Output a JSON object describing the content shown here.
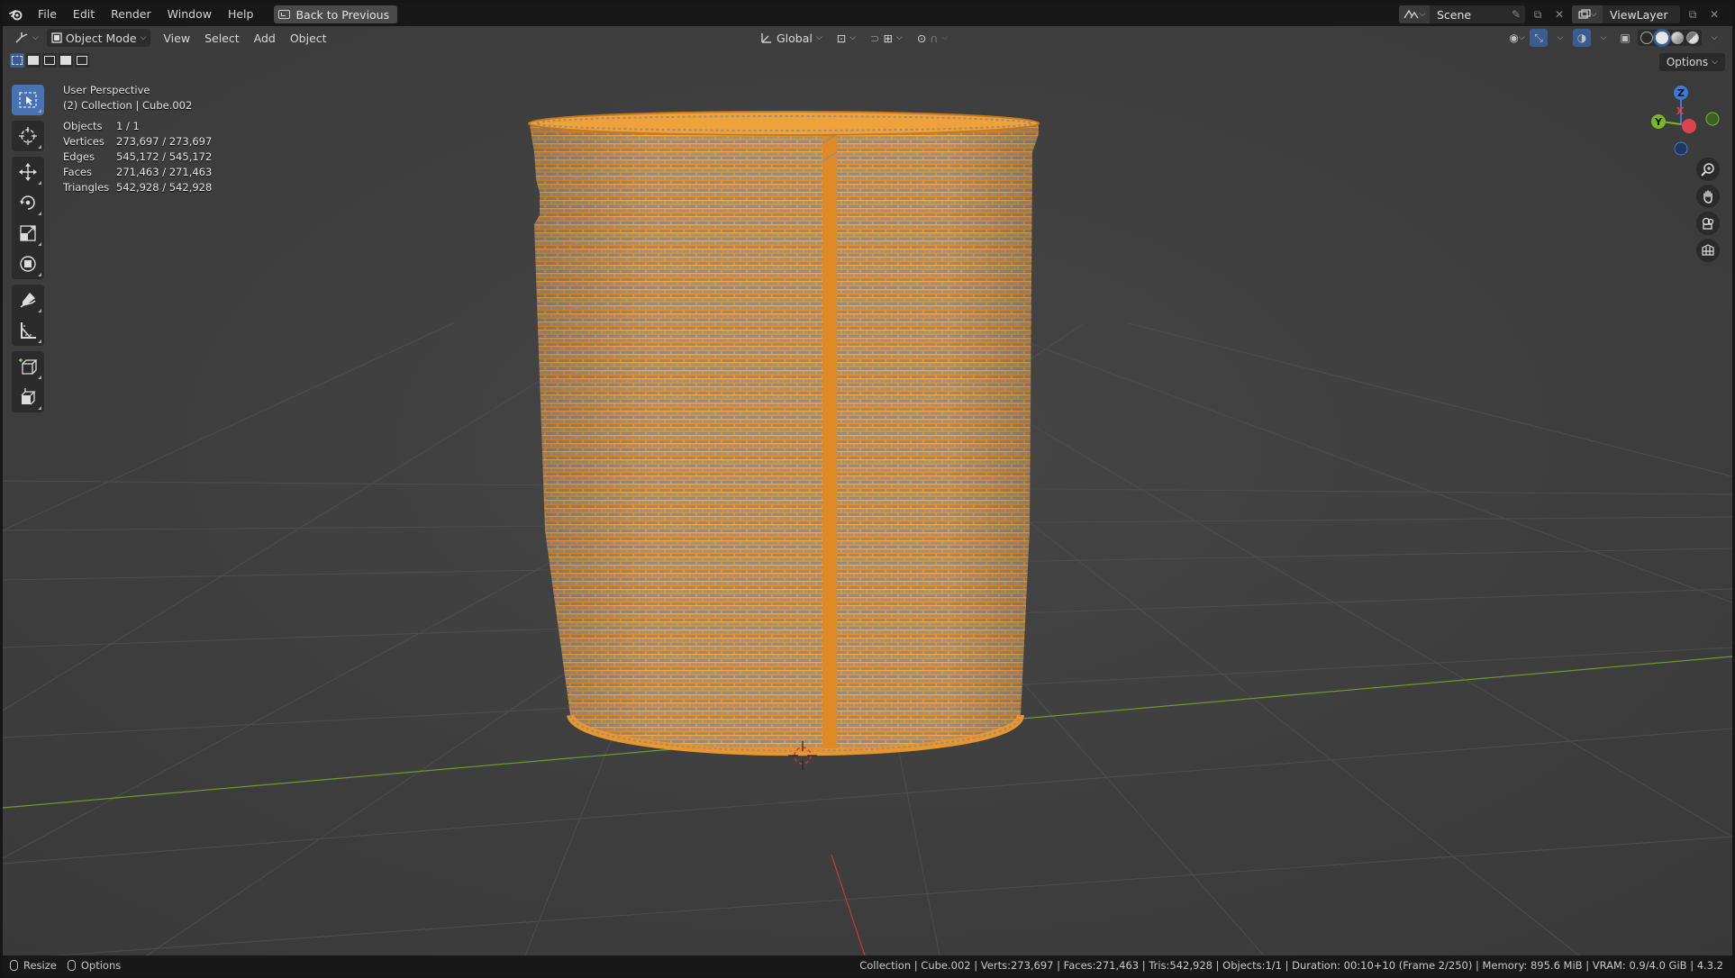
{
  "menubar": {
    "items": [
      "File",
      "Edit",
      "Render",
      "Window",
      "Help"
    ],
    "back_button": "Back to Previous",
    "scene": "Scene",
    "view_layer": "ViewLayer"
  },
  "viewport_header": {
    "mode": "Object Mode",
    "menus": [
      "View",
      "Select",
      "Add",
      "Object"
    ],
    "orientation": "Global",
    "options": "Options"
  },
  "overlay": {
    "perspective": "User Perspective",
    "collection": "(2) Collection | Cube.002",
    "stats": [
      {
        "label": "Objects",
        "value": "1 / 1"
      },
      {
        "label": "Vertices",
        "value": "273,697 / 273,697"
      },
      {
        "label": "Edges",
        "value": "545,172 / 545,172"
      },
      {
        "label": "Faces",
        "value": "271,463 / 271,463"
      },
      {
        "label": "Triangles",
        "value": "542,928 / 542,928"
      }
    ]
  },
  "gizmo": {
    "z": "Z",
    "y": "Y",
    "x": "X"
  },
  "statusbar": {
    "left_action": "Resize",
    "left_options": "Options",
    "info": "Collection | Cube.002 | Verts:273,697 | Faces:271,463 | Tris:542,928 | Objects:1/1 | Duration: 00:10+10 (Frame 2/250) | Memory: 895.6 MiB | VRAM: 0.9/4.0 GiB | 4.3.2"
  },
  "colors": {
    "selection_orange": "#f59e2d",
    "active_blue": "#4772b3",
    "axis_x_red": "#c83a3a",
    "axis_y_green": "#6a9e2a",
    "grid": "#4a4a4a",
    "background": "#3d3d3d"
  }
}
